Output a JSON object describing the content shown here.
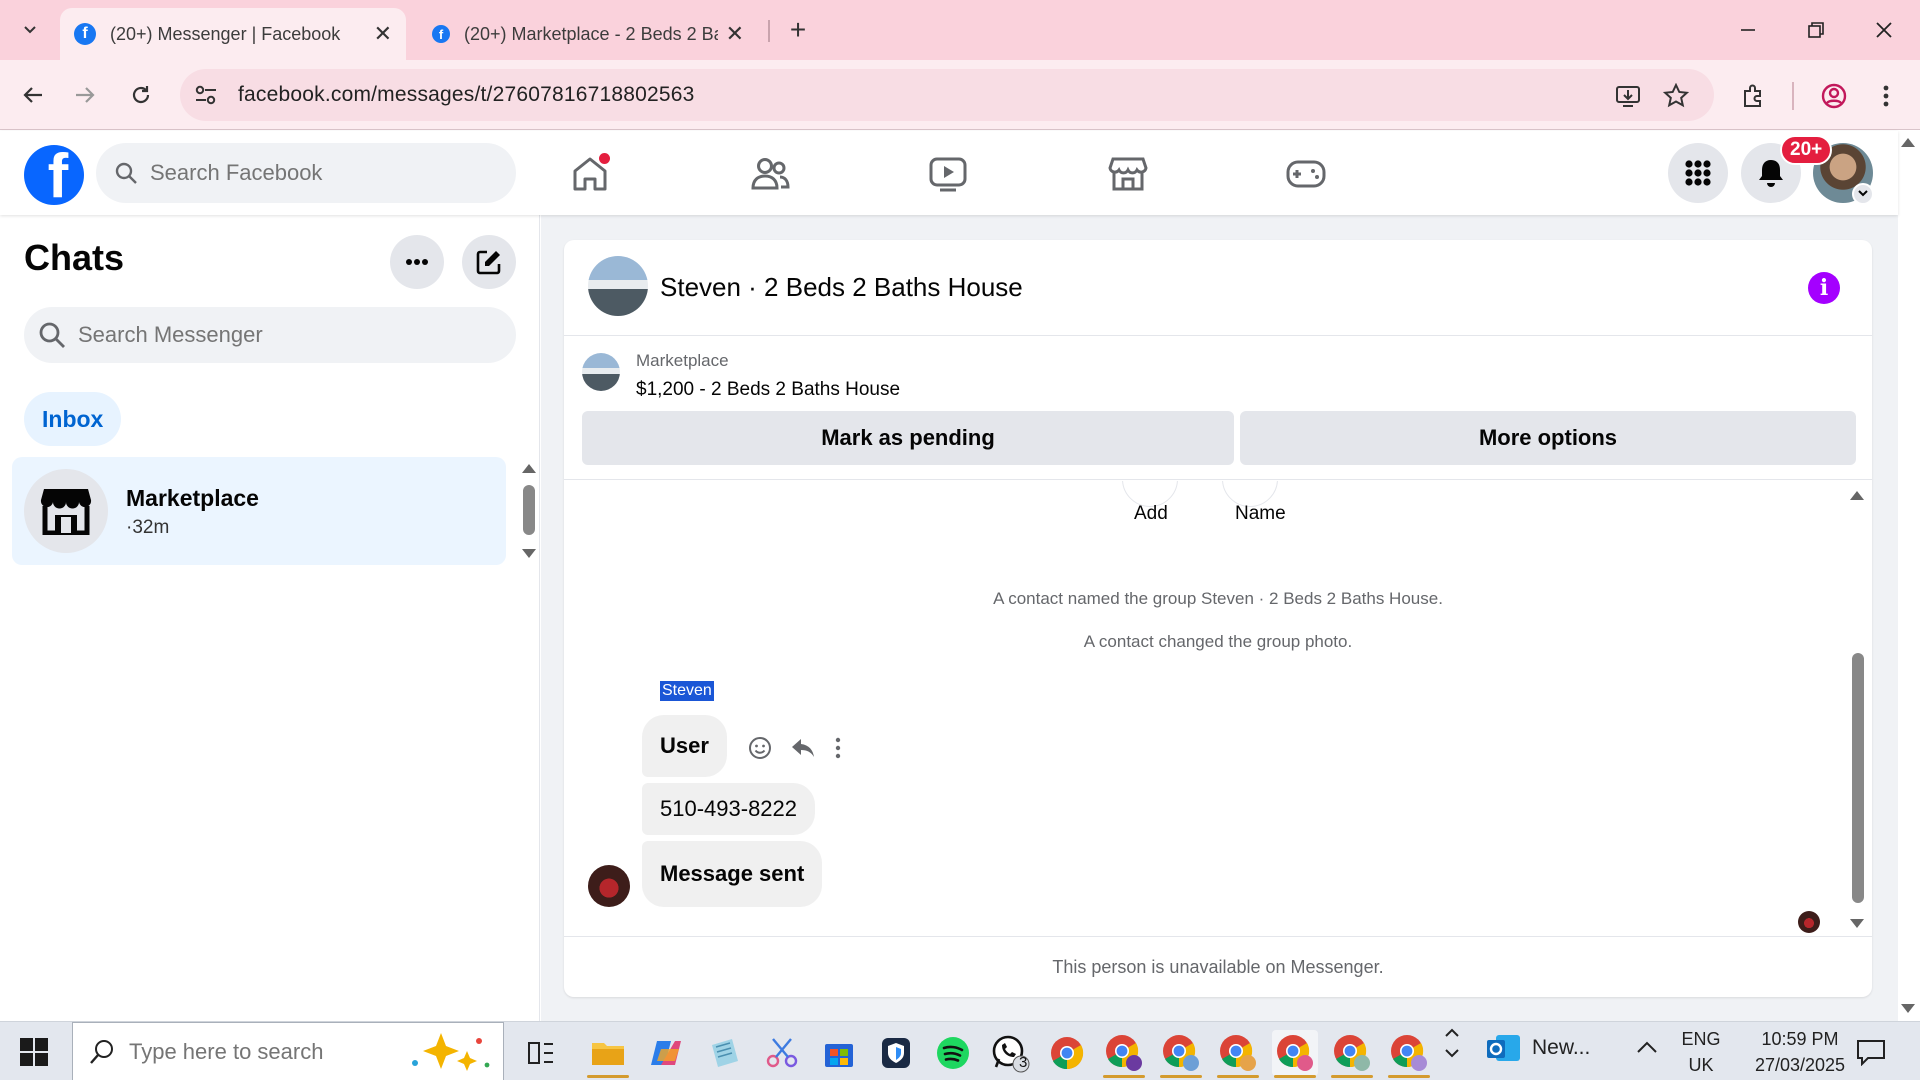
{
  "browser": {
    "tabs": [
      {
        "title": "(20+) Messenger | Facebook",
        "active": true
      },
      {
        "title": "(20+) Marketplace - 2 Beds 2 Ba",
        "active": false
      }
    ],
    "url": "facebook.com/messages/t/27607816718802563"
  },
  "fb_header": {
    "logo": "f",
    "search_placeholder": "Search Facebook",
    "notification_badge": "20+",
    "nav_icons": [
      "home-icon",
      "friends-icon",
      "video-icon",
      "marketplace-icon",
      "gaming-icon"
    ]
  },
  "chats": {
    "title": "Chats",
    "search_placeholder": "Search Messenger",
    "filter": "Inbox",
    "items": [
      {
        "name": "Marketplace",
        "time": "·32m"
      }
    ]
  },
  "conversation": {
    "title": "Steven · 2 Beds 2 Baths House",
    "listing": {
      "label": "Marketplace",
      "title": "$1,200 - 2 Beds 2 Baths House"
    },
    "actions": {
      "pending": "Mark as pending",
      "more": "More options"
    },
    "quick_actions": [
      "Add",
      "Name"
    ],
    "system_messages": [
      "A contact named the group Steven · 2 Beds 2 Baths House.",
      "A contact changed the group photo."
    ],
    "sender": "Steven",
    "messages": [
      "User",
      "510-493-8222",
      "Message sent"
    ],
    "footer": "This person is unavailable on Messenger."
  },
  "taskbar": {
    "search_placeholder": "Type here to search",
    "whatsapp_badge": "3",
    "news_label": "New...",
    "language": [
      "ENG",
      "UK"
    ],
    "time": "10:59 PM",
    "date": "27/03/2025"
  },
  "colors": {
    "tab_strip": "#fad2dc",
    "toolbar": "#fcecf0",
    "facebook_blue": "#0866ff",
    "notification_red": "#e41e3f",
    "info_purple": "#a400ff"
  }
}
